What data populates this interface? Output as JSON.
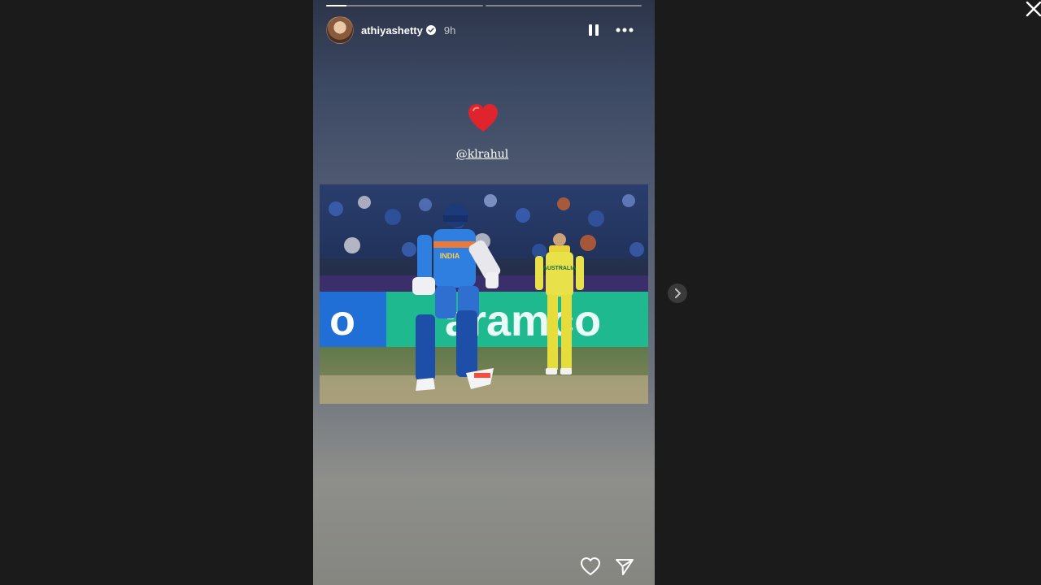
{
  "story": {
    "username": "athiyashetty",
    "time_ago": "9h",
    "progress": [
      0.13,
      0
    ],
    "mention": "@klrahul",
    "sticker_icon": "heart-icon",
    "photo_banner_text": "aramco",
    "jersey_text": "INDIA",
    "opponent_jersey_text": "AUSTRALIA"
  },
  "icons": {
    "close": "close-icon",
    "pause": "pause-icon",
    "more": "more-options-icon",
    "like": "heart-outline-icon",
    "share": "send-icon",
    "next": "chevron-right-icon"
  },
  "colors": {
    "page_bg": "#1b1b1b",
    "heart_red": "#e0242d",
    "verified_blue": "#ffffff"
  }
}
